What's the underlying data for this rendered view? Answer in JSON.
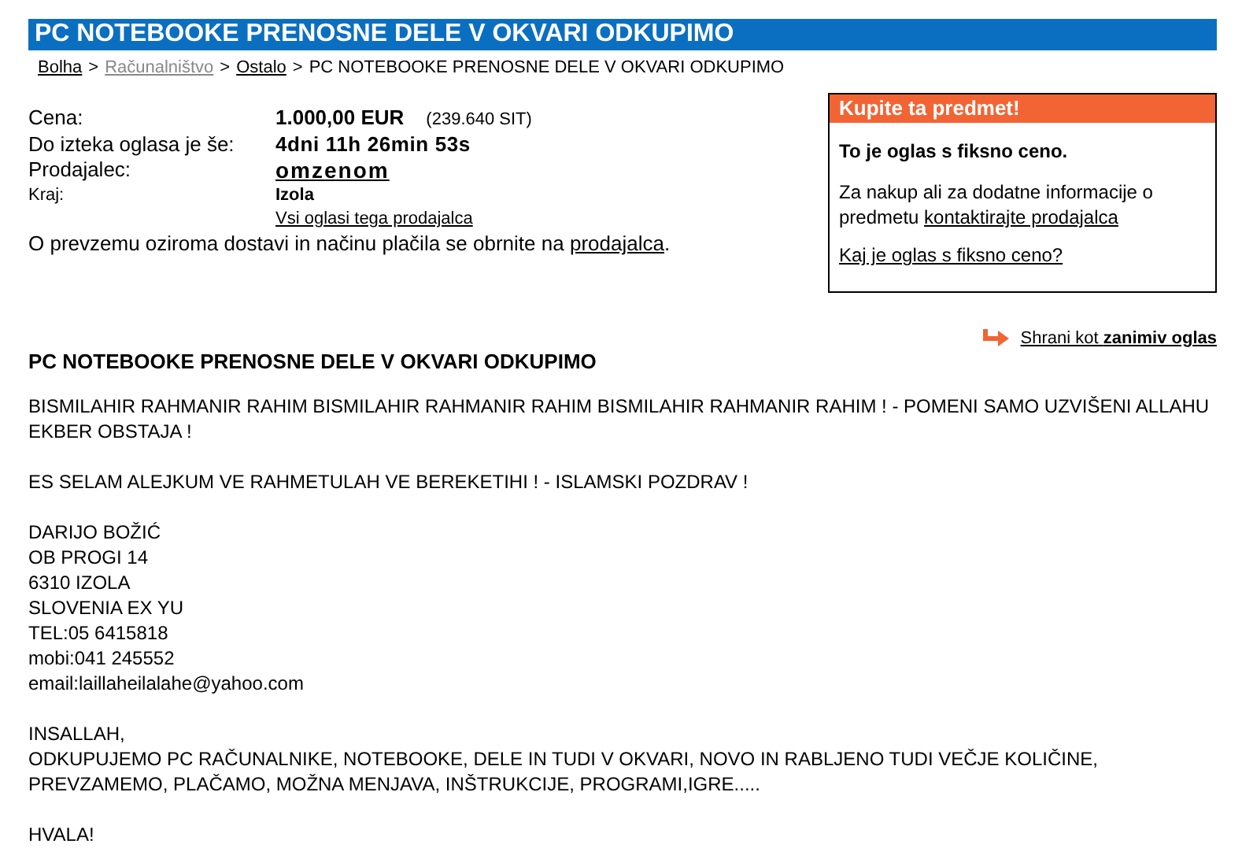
{
  "title": "PC NOTEBOOKE PRENOSNE DELE V OKVARI ODKUPIMO",
  "breadcrumb": {
    "separator": ">",
    "items": [
      {
        "text": "Bolha",
        "kind": "link"
      },
      {
        "text": "Računalništvo",
        "kind": "muted_link"
      },
      {
        "text": "Ostalo",
        "kind": "link"
      },
      {
        "text": "PC NOTEBOOKE PRENOSNE DELE V OKVARI ODKUPIMO",
        "kind": "current"
      }
    ]
  },
  "details": [
    {
      "label": "Cena:",
      "value": "1.000,00 EUR",
      "note": "(239.640 SIT)",
      "kind": "price"
    },
    {
      "label": "Do izteka oglasa je še:",
      "value": "4dni 11h 26min 53s",
      "kind": "countdown"
    },
    {
      "label": "Prodajalec:",
      "value": "omzenom",
      "kind": "seller"
    },
    {
      "label": "Kraj:",
      "value": "Izola",
      "kind": "place"
    }
  ],
  "seller_ads_link": "Vsi oglasi tega prodajalca",
  "contact_note": {
    "text": "O prevzemu oziroma dostavi in načinu plačila se obrnite na",
    "link": "prodajalca",
    "end": "."
  },
  "buy_box": {
    "header": "Kupite ta predmet!",
    "fixed_price": "To je oglas s fiksno ceno.",
    "info_text": "Za nakup ali za dodatne informacije o predmetu",
    "info_link": "kontaktirajte prodajalca",
    "help_link": "Kaj je oglas s fiksno ceno?"
  },
  "save_link": {
    "text": "Shrani kot",
    "bold": "zanimiv oglas"
  },
  "description": {
    "title": "PC NOTEBOOKE PRENOSNE DELE V OKVARI ODKUPIMO",
    "paragraphs": [
      [
        "BISMILAHIR RAHMANIR RAHIM BISMILAHIR RAHMANIR RAHIM BISMILAHIR RAHMANIR RAHIM ! - POMENI SAMO UZVIŠENI ALLAHU EKBER OBSTAJA !"
      ],
      [
        "ES SELAM ALEJKUM VE RAHMETULAH VE BEREKETIHI ! - ISLAMSKI POZDRAV !"
      ],
      [
        "DARIJO BOŽIĆ",
        "OB PROGI 14",
        "6310 IZOLA",
        "SLOVENIA EX YU",
        "TEL:05 6415818",
        "mobi:041 245552",
        "email:laillaheilalahe@yahoo.com"
      ],
      [
        "INSALLAH,",
        "ODKUPUJEMO PC RAČUNALNIKE, NOTEBOOKE, DELE IN TUDI V OKVARI, NOVO IN RABLJENO TUDI VEČJE KOLIČINE, PREVZAMEMO, PLAČAMO, MOŽNA MENJAVA, INŠTRUKCIJE, PROGRAMI,IGRE....."
      ],
      [
        "HVALA!"
      ]
    ]
  }
}
